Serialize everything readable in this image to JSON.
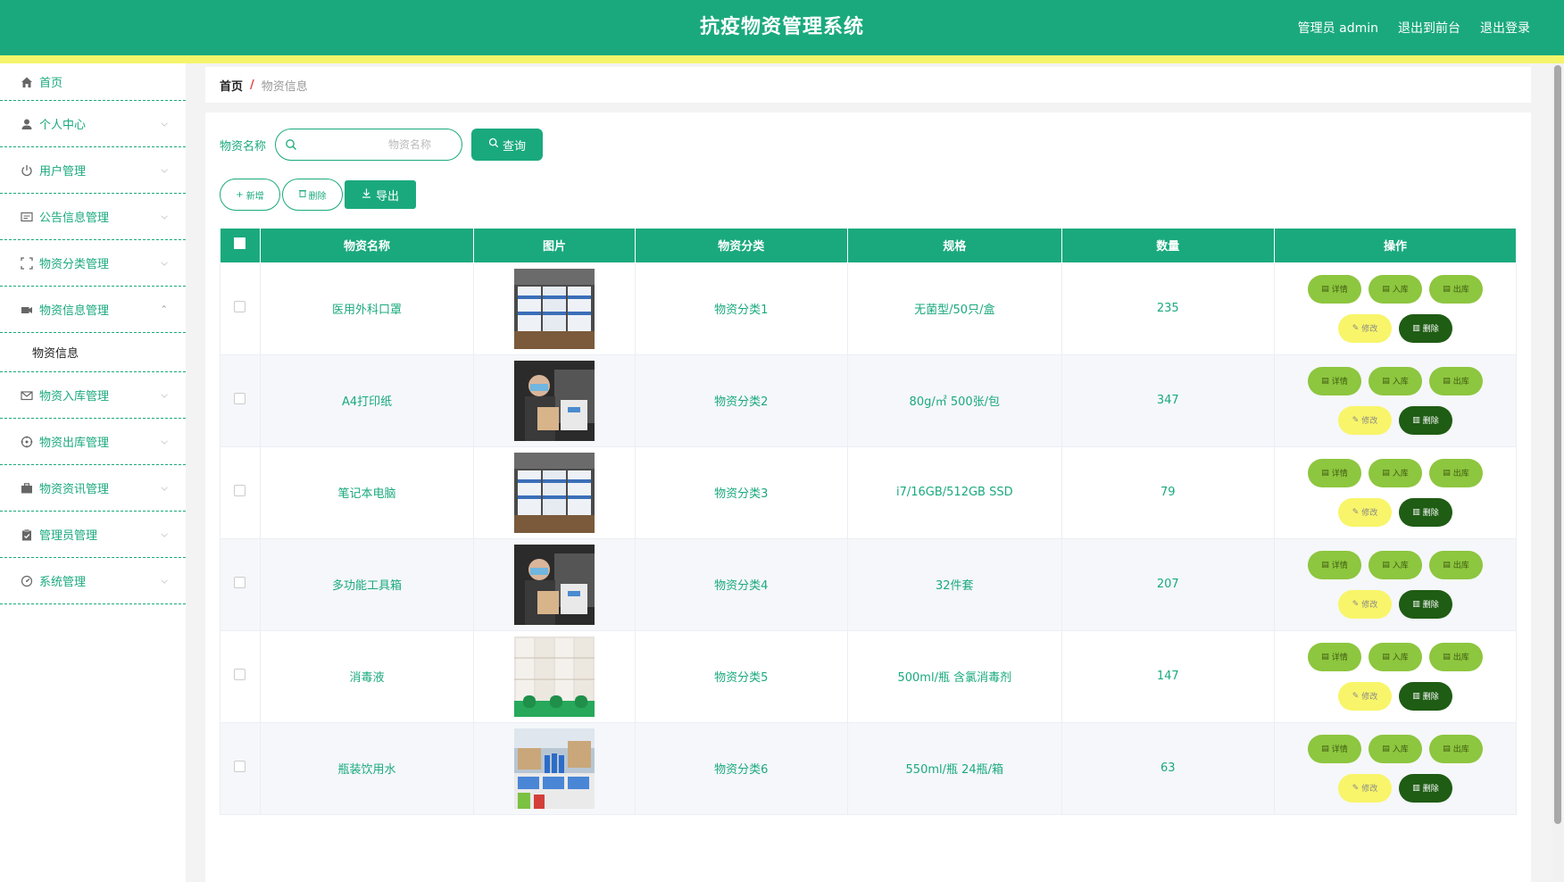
{
  "header": {
    "title": "抗疫物资管理系统",
    "user_label": "管理员 admin",
    "frontend_link": "退出到前台",
    "logout_link": "退出登录"
  },
  "sidebar": {
    "items": [
      {
        "label": "首页",
        "icon": "home-icon"
      },
      {
        "label": "个人中心",
        "icon": "user-icon"
      },
      {
        "label": "用户管理",
        "icon": "power-icon"
      },
      {
        "label": "公告信息管理",
        "icon": "notice-icon"
      },
      {
        "label": "物资分类管理",
        "icon": "fullscreen-icon"
      },
      {
        "label": "物资信息管理",
        "icon": "camera-icon",
        "expanded": true,
        "children": [
          "物资信息"
        ]
      },
      {
        "label": "物资入库管理",
        "icon": "mail-icon"
      },
      {
        "label": "物资出库管理",
        "icon": "target-icon"
      },
      {
        "label": "物资资讯管理",
        "icon": "briefcase-icon"
      },
      {
        "label": "管理员管理",
        "icon": "clipboard-icon"
      },
      {
        "label": "系统管理",
        "icon": "gauge-icon"
      }
    ]
  },
  "breadcrumb": {
    "home": "首页",
    "separator": "/",
    "current": "物资信息"
  },
  "search": {
    "label": "物资名称",
    "placeholder": "物资名称",
    "value": "",
    "query_button": "查询"
  },
  "actions": {
    "add": "新增",
    "delete": "删除",
    "export": "导出"
  },
  "table": {
    "columns": [
      "物资名称",
      "图片",
      "物资分类",
      "规格",
      "数量",
      "操作"
    ],
    "rows": [
      {
        "name": "医用外科口罩",
        "image": "warehouse-boxes",
        "category": "物资分类1",
        "spec": "无菌型/50只/盒",
        "qty": "235"
      },
      {
        "name": "A4打印纸",
        "image": "person-with-box",
        "category": "物资分类2",
        "spec": "80g/㎡ 500张/包",
        "qty": "347"
      },
      {
        "name": "笔记本电脑",
        "image": "warehouse-boxes",
        "category": "物资分类3",
        "spec": "i7/16GB/512GB SSD",
        "qty": "79"
      },
      {
        "name": "多功能工具箱",
        "image": "person-with-box",
        "category": "物资分类4",
        "spec": "32件套",
        "qty": "207"
      },
      {
        "name": "消毒液",
        "image": "stacked-cartons",
        "category": "物资分类5",
        "spec": "500ml/瓶 含氯消毒剂",
        "qty": "147"
      },
      {
        "name": "瓶装饮用水",
        "image": "water-bottles",
        "category": "物资分类6",
        "spec": "550ml/瓶 24瓶/箱",
        "qty": "63"
      }
    ],
    "row_buttons": {
      "detail": "详情",
      "in": "入库",
      "out": "出库",
      "edit": "修改",
      "delete": "删除"
    }
  },
  "colors": {
    "primary": "#1aa97d",
    "accent_yellow": "#f4f56a",
    "lime": "#8dc63f",
    "dark_green": "#1f5c14"
  }
}
